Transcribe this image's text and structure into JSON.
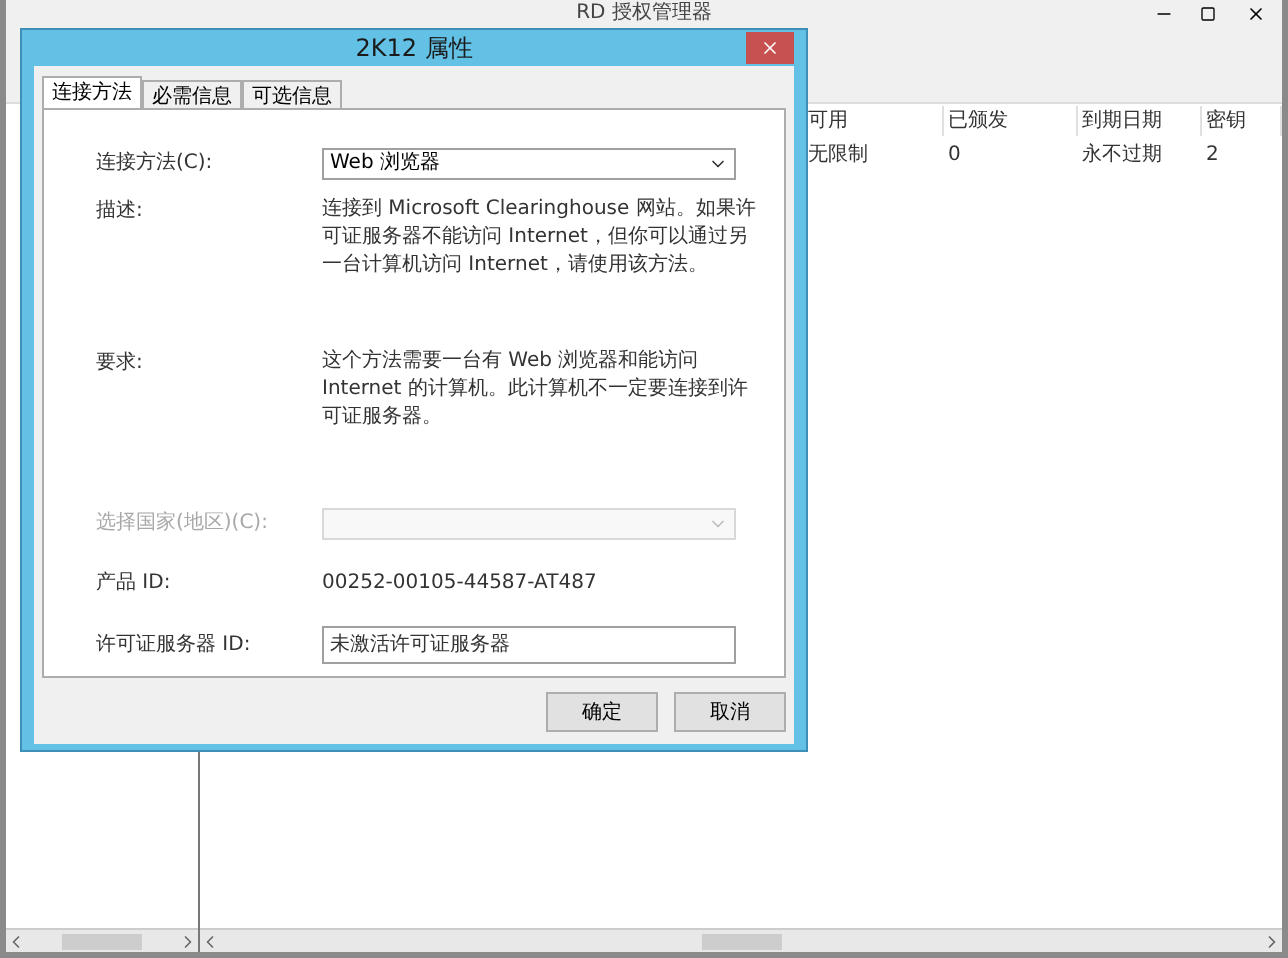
{
  "background_window": {
    "title": "RD 授权管理器",
    "list": {
      "columns": [
        "可用",
        "已颁发",
        "到期日期",
        "密钥"
      ],
      "rows": [
        [
          "无限制",
          "0",
          "永不过期",
          "2"
        ]
      ]
    }
  },
  "dialog": {
    "title": "2K12 属性",
    "tabs": [
      {
        "label": "连接方法",
        "selected": true
      },
      {
        "label": "必需信息",
        "selected": false
      },
      {
        "label": "可选信息",
        "selected": false
      }
    ],
    "fields": [
      {
        "kind": "select",
        "label": "连接方法(C):",
        "value": "Web 浏览器",
        "disabled": false
      },
      {
        "kind": "paragraph",
        "label": "描述:",
        "value": "连接到 Microsoft Clearinghouse 网站。如果许可证服务器不能访问 Internet，但你可以通过另一台计算机访问 Internet，请使用该方法。"
      },
      {
        "kind": "paragraph",
        "label": "要求:",
        "value": "这个方法需要一台有 Web 浏览器和能访问 Internet 的计算机。此计算机不一定要连接到许可证服务器。"
      },
      {
        "kind": "select",
        "label": "选择国家(地区)(C):",
        "disabled": true
      },
      {
        "kind": "value",
        "label": "产品 ID:",
        "value": "00252-00105-44587-AT487"
      },
      {
        "kind": "input",
        "label": "许可证服务器 ID:",
        "value": "未激活许可证服务器"
      }
    ],
    "buttons": [
      "确定",
      "取消"
    ]
  }
}
